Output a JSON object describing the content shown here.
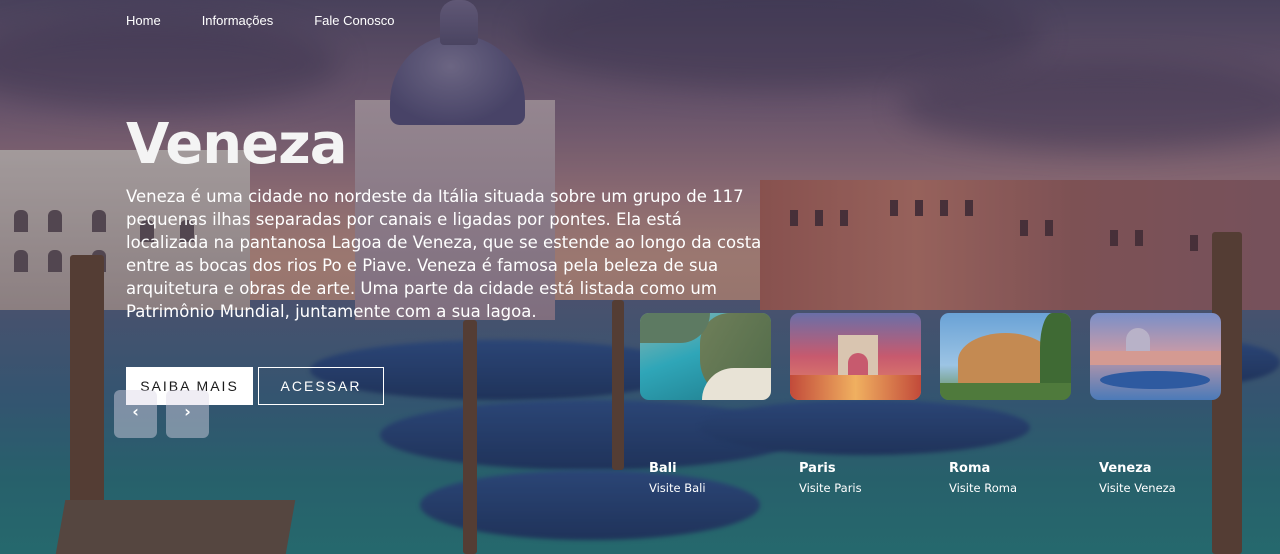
{
  "nav": {
    "items": [
      {
        "label": "Home"
      },
      {
        "label": "Informações"
      },
      {
        "label": "Fale Conosco"
      }
    ]
  },
  "hero": {
    "title": "Veneza",
    "description": "Veneza é uma cidade no nordeste da Itália situada sobre um grupo de 117 pequenas ilhas separadas por canais e ligadas por pontes. Ela está localizada na pantanosa Lagoa de Veneza, que se estende ao longo da costa entre as bocas dos rios Po e Piave. Veneza é famosa pela beleza de sua arquitetura e obras de arte. Uma parte da cidade está listada como um Patrimônio Mundial, juntamente com a sua lagoa.",
    "primary_button": "SAIBA MAIS",
    "secondary_button": "ACESSAR"
  },
  "slider": {
    "prev_icon": "chevron-left-icon",
    "prev_glyph": "‹",
    "next_icon": "chevron-right-icon",
    "next_glyph": "›"
  },
  "cards": [
    {
      "name": "Bali",
      "subtitle": "Visite Bali",
      "accent": "#2fa6b8"
    },
    {
      "name": "Paris",
      "subtitle": "Visite Paris",
      "accent": "#c75a6e"
    },
    {
      "name": "Roma",
      "subtitle": "Visite Roma",
      "accent": "#c48a52"
    },
    {
      "name": "Veneza",
      "subtitle": "Visite Veneza",
      "accent": "#7a8fc8"
    }
  ]
}
